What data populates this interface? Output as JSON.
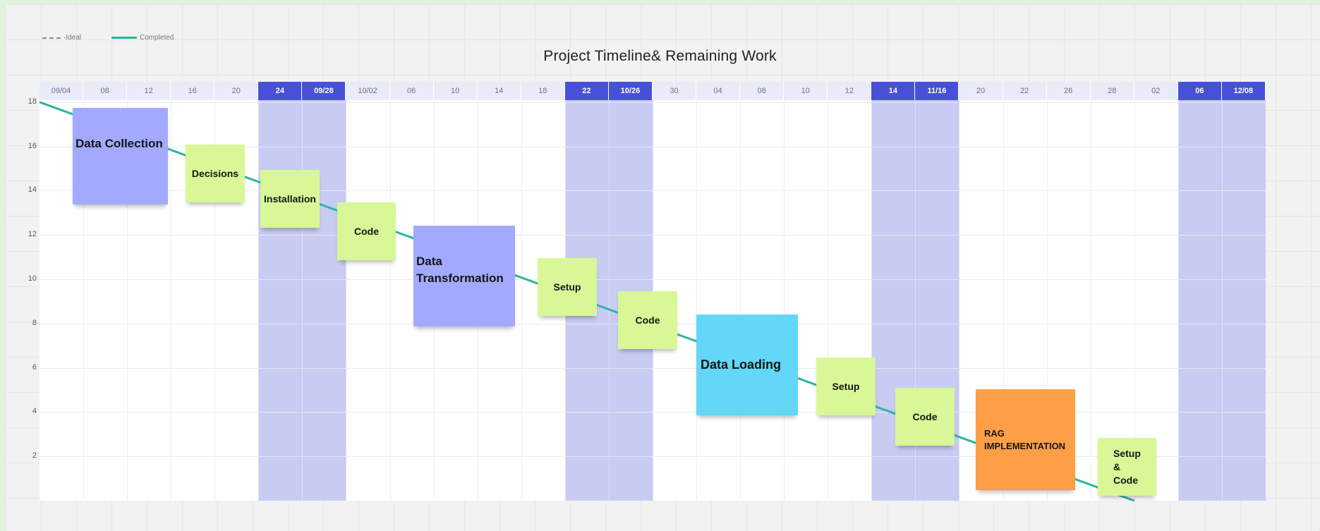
{
  "title": "Project Timeline& Remaining Work",
  "legend": {
    "ideal_label": "-Ideal",
    "completed_label": "Completed"
  },
  "colors": {
    "weekend_band": "#c8cbf2",
    "weekend_header": "#4650d8",
    "burndown_line": "#2bb5a0",
    "note_green": "#d8f796",
    "note_blue": "#a2aaff",
    "note_cyan": "#64d6f8",
    "note_orange": "#fe9f47"
  },
  "chart_data": {
    "type": "line",
    "title": "Project Timeline& Remaining Work",
    "x_dates": [
      "09/04",
      "08",
      "12",
      "16",
      "20",
      "24",
      "09/28",
      "10/02",
      "06",
      "10",
      "14",
      "18",
      "22",
      "10/26",
      "30",
      "04",
      "08",
      "10",
      "12",
      "14",
      "11/16",
      "20",
      "22",
      "26",
      "28",
      "02",
      "06",
      "12/08"
    ],
    "highlighted_columns": [
      "24",
      "09/28",
      "22",
      "10/26",
      "14",
      "11/16",
      "06",
      "12/08"
    ],
    "yticks": [
      18,
      16,
      14,
      12,
      10,
      8,
      6,
      4,
      2
    ],
    "ylim": [
      0,
      18
    ],
    "grid": true,
    "legend_position": "top-left",
    "series": [
      {
        "name": "Completed",
        "points": [
          {
            "x": "09/04",
            "y": 18
          },
          {
            "x": "02",
            "y": 0
          }
        ]
      }
    ]
  },
  "tasks": [
    {
      "label": "Data Collection",
      "color": "blue"
    },
    {
      "label": "Decisions",
      "color": "green"
    },
    {
      "label": "Installation",
      "color": "green"
    },
    {
      "label": "Code",
      "color": "green"
    },
    {
      "label": "Data Transformation",
      "color": "blue"
    },
    {
      "label": "Setup",
      "color": "green"
    },
    {
      "label": "Code",
      "color": "green"
    },
    {
      "label": "Data Loading",
      "color": "cyan"
    },
    {
      "label": "Setup",
      "color": "green"
    },
    {
      "label": "Code",
      "color": "green"
    },
    {
      "label": "RAG IMPLEMENTATION",
      "color": "orange"
    },
    {
      "label": "Setup & Code",
      "color": "green"
    }
  ]
}
